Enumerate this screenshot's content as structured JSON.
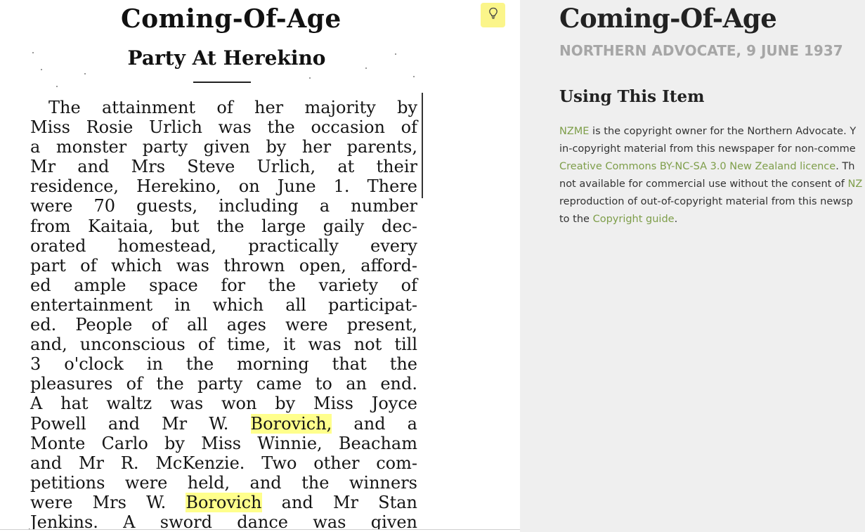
{
  "clipping": {
    "title": "Coming-Of-Age",
    "subtitle": "Party At Herekino",
    "lines": [
      {
        "t": "The attainment of her majority by"
      },
      {
        "t": "Miss Rosie Urlich was the occasion of"
      },
      {
        "t": "a monster party given by her parents,"
      },
      {
        "t": "Mr and Mrs Steve Urlich, at their"
      },
      {
        "t": "residence, Herekino, on June 1. There"
      },
      {
        "t": "were 70 guests, including a number"
      },
      {
        "t": "from Kaitaia, but the large gaily dec-"
      },
      {
        "t": "orated homestead, practically every"
      },
      {
        "t": "part of which was thrown open, afford-"
      },
      {
        "t": "ed ample space for the variety of"
      },
      {
        "t": "entertainment in which all participat-"
      },
      {
        "t": "ed. People of all ages were present,"
      },
      {
        "t": "and, unconscious of time, it was not till"
      },
      {
        "t": "3 o'clock in the morning that the"
      },
      {
        "t": "pleasures of the party came to an end."
      },
      {
        "t": "A hat waltz was won by Miss Joyce"
      },
      {
        "a": "Powell and Mr W. ",
        "h": "Borovich,",
        "b": " and a"
      },
      {
        "t": "Monte Carlo by Miss Winnie, Beacham"
      },
      {
        "t": "and Mr R. McKenzie. Two other com-"
      },
      {
        "t": "petitions were held, and the winners"
      },
      {
        "a": "were Mrs W. ",
        "h": "Borovich",
        "b": " and Mr Stan"
      },
      {
        "t": "Jenkins. A sword dance was given"
      }
    ],
    "highlight_color": "#ffff8c"
  },
  "hint_button": {
    "icon": "lightbulb-icon",
    "color": "#fbf58a"
  },
  "info": {
    "title": "Coming-Of-Age",
    "source": "NORTHERN ADVOCATE, 9 JUNE 1937",
    "section_heading": "Using This Item",
    "link_color": "#7e9e4a",
    "body_lines": [
      [
        {
          "link": "NZME"
        },
        {
          "text": " is the copyright owner for the Northern Advocate. Y"
        }
      ],
      [
        {
          "text": "in-copyright material from this newspaper for non-comme"
        }
      ],
      [
        {
          "link": "Creative Commons BY-NC-SA 3.0 New Zealand licence"
        },
        {
          "text": ". Th"
        }
      ],
      [
        {
          "text": "not available for commercial use without the consent of "
        },
        {
          "link": "NZ"
        }
      ],
      [
        {
          "text": "reproduction of out-of-copyright material from this newsp"
        }
      ],
      [
        {
          "text": "to the "
        },
        {
          "link": "Copyright guide"
        },
        {
          "text": "."
        }
      ]
    ]
  }
}
